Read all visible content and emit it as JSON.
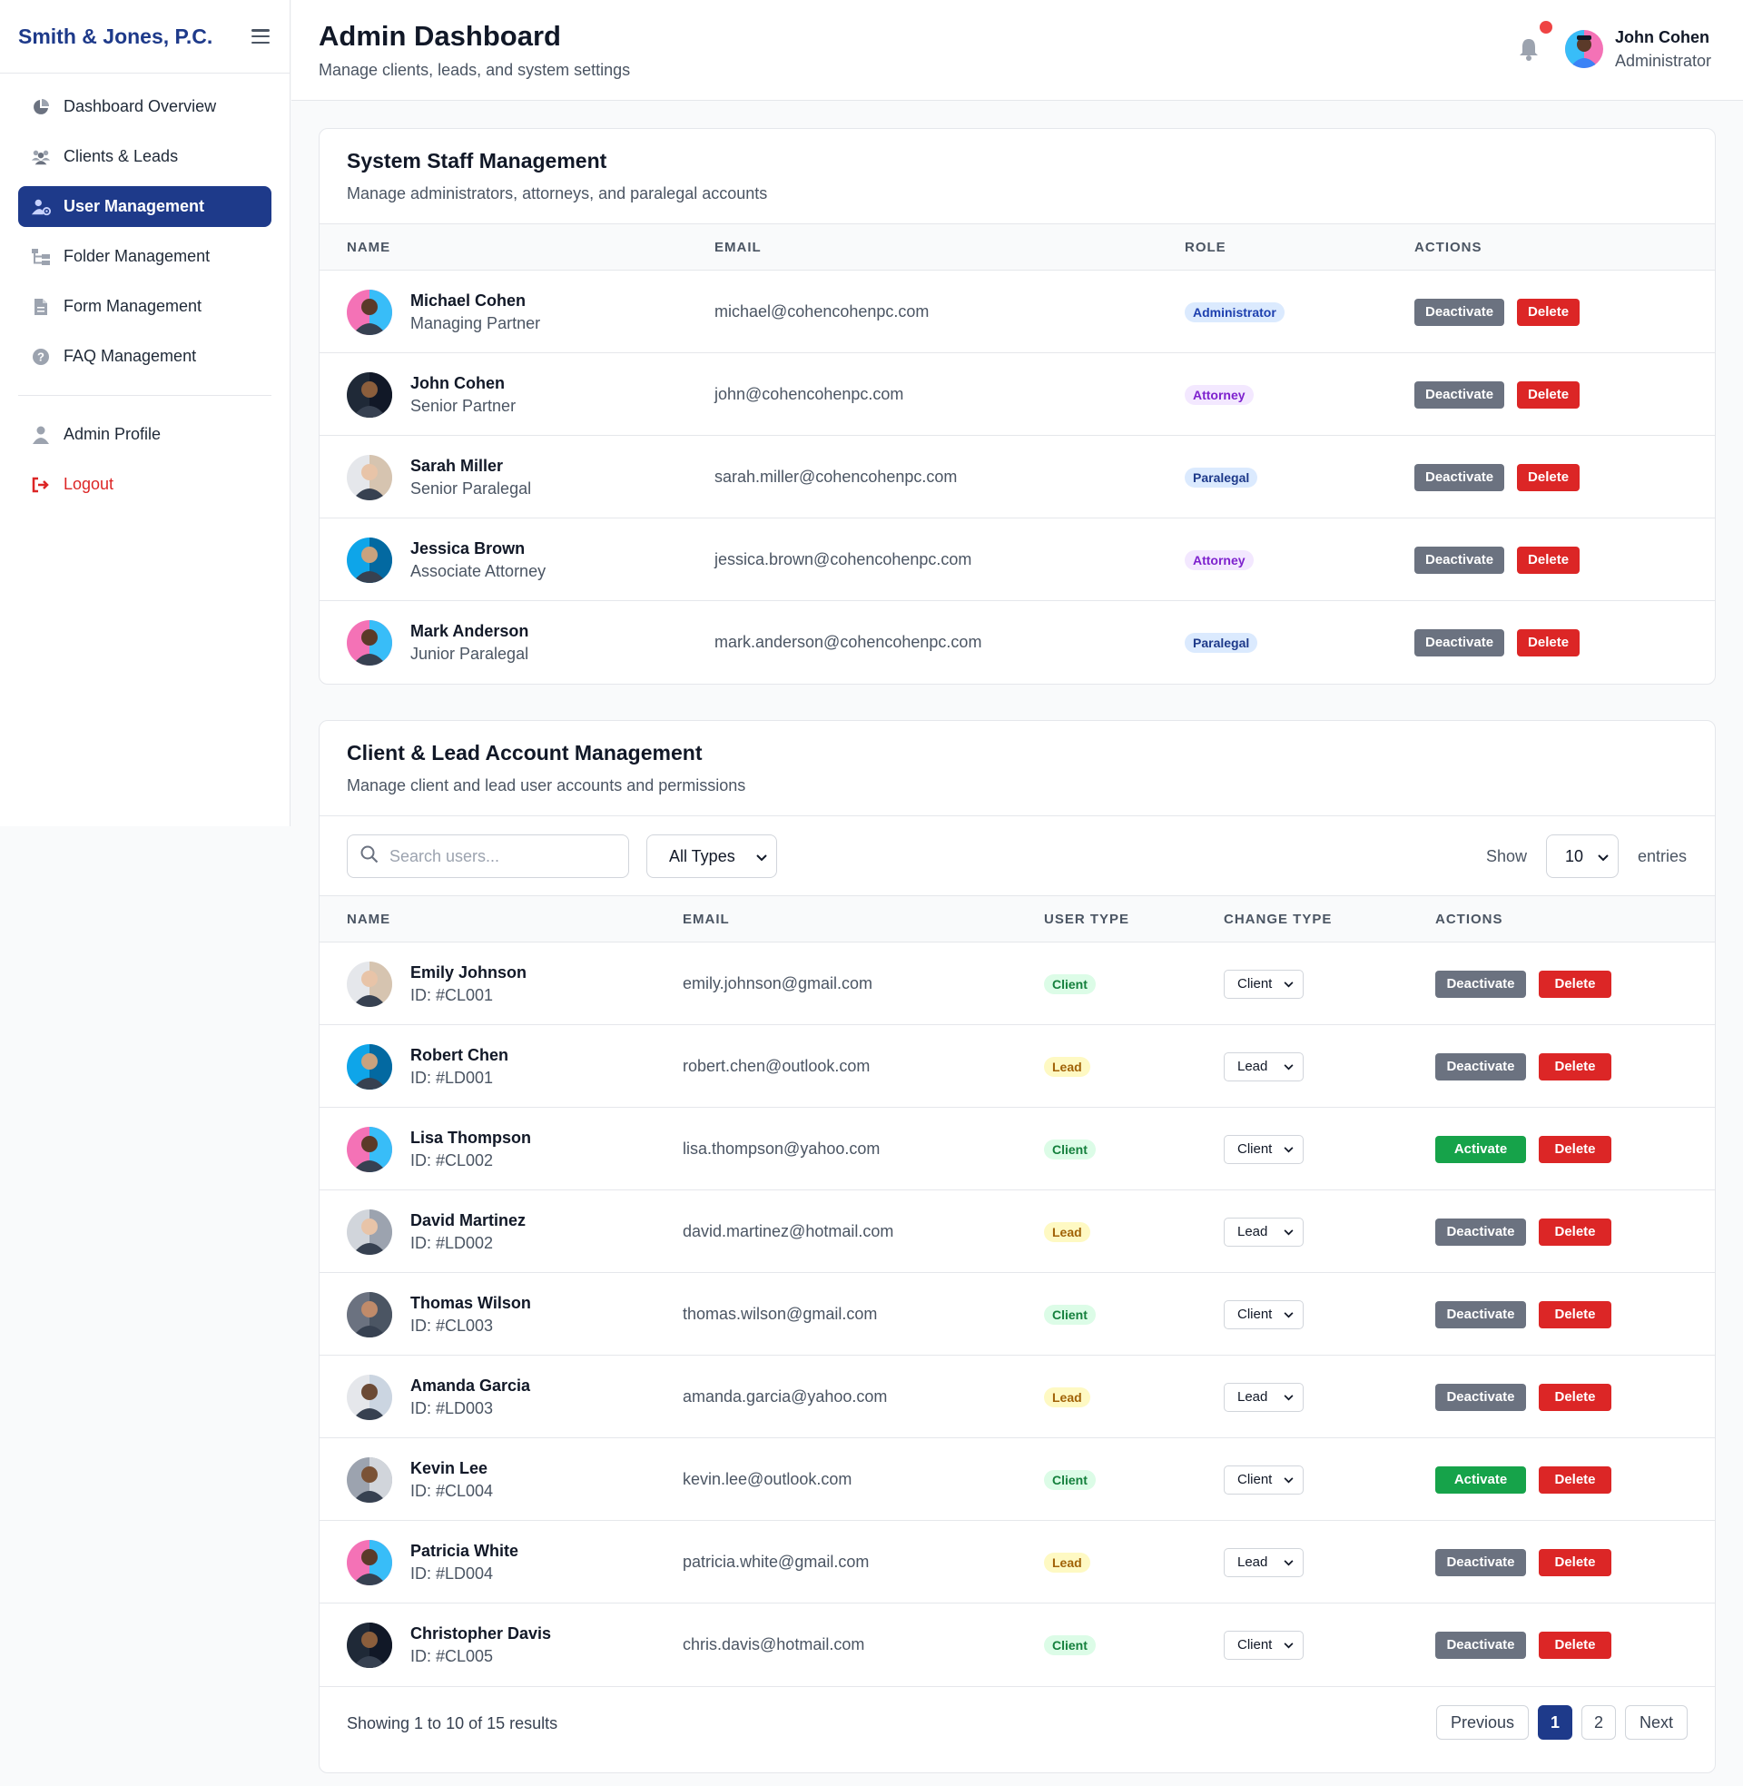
{
  "brand": "Smith & Jones, P.C.",
  "nav": {
    "items": [
      {
        "label": "Dashboard Overview",
        "icon": "pie-chart-icon"
      },
      {
        "label": "Clients & Leads",
        "icon": "users-icon"
      },
      {
        "label": "User Management",
        "icon": "user-gear-icon"
      },
      {
        "label": "Folder Management",
        "icon": "folder-tree-icon"
      },
      {
        "label": "Form Management",
        "icon": "file-icon"
      },
      {
        "label": "FAQ Management",
        "icon": "question-circle-icon"
      }
    ],
    "profile": "Admin Profile",
    "logout": "Logout"
  },
  "header": {
    "title": "Admin Dashboard",
    "subtitle": "Manage clients, leads, and system settings",
    "user_name": "John Cohen",
    "user_role": "Administrator"
  },
  "staff": {
    "title": "System Staff Management",
    "subtitle": "Manage administrators, attorneys, and paralegal accounts",
    "columns": [
      "Name",
      "Email",
      "Role",
      "Actions"
    ],
    "deactivate": "Deactivate",
    "delete": "Delete",
    "rows": [
      {
        "name": "Michael Cohen",
        "title": "Managing Partner",
        "email": "michael@cohencohenpc.com",
        "role": "Administrator"
      },
      {
        "name": "John Cohen",
        "title": "Senior Partner",
        "email": "john@cohencohenpc.com",
        "role": "Attorney"
      },
      {
        "name": "Sarah Miller",
        "title": "Senior Paralegal",
        "email": "sarah.miller@cohencohenpc.com",
        "role": "Paralegal"
      },
      {
        "name": "Jessica Brown",
        "title": "Associate Attorney",
        "email": "jessica.brown@cohencohenpc.com",
        "role": "Attorney"
      },
      {
        "name": "Mark Anderson",
        "title": "Junior Paralegal",
        "email": "mark.anderson@cohencohenpc.com",
        "role": "Paralegal"
      }
    ]
  },
  "clients": {
    "title": "Client & Lead Account Management",
    "subtitle": "Manage client and lead user accounts and permissions",
    "search_placeholder": "Search users...",
    "type_filter": "All Types",
    "show_label": "Show",
    "show_value": "10",
    "entries_label": "entries",
    "columns": [
      "Name",
      "Email",
      "User Type",
      "Change Type",
      "Actions"
    ],
    "delete": "Delete",
    "rows": [
      {
        "name": "Emily Johnson",
        "id": "ID: #CL001",
        "email": "emily.johnson@gmail.com",
        "type": "Client",
        "change": "Client",
        "action": "Deactivate"
      },
      {
        "name": "Robert Chen",
        "id": "ID: #LD001",
        "email": "robert.chen@outlook.com",
        "type": "Lead",
        "change": "Lead",
        "action": "Deactivate"
      },
      {
        "name": "Lisa Thompson",
        "id": "ID: #CL002",
        "email": "lisa.thompson@yahoo.com",
        "type": "Client",
        "change": "Client",
        "action": "Activate"
      },
      {
        "name": "David Martinez",
        "id": "ID: #LD002",
        "email": "david.martinez@hotmail.com",
        "type": "Lead",
        "change": "Lead",
        "action": "Deactivate"
      },
      {
        "name": "Thomas Wilson",
        "id": "ID: #CL003",
        "email": "thomas.wilson@gmail.com",
        "type": "Client",
        "change": "Client",
        "action": "Deactivate"
      },
      {
        "name": "Amanda Garcia",
        "id": "ID: #LD003",
        "email": "amanda.garcia@yahoo.com",
        "type": "Lead",
        "change": "Lead",
        "action": "Deactivate"
      },
      {
        "name": "Kevin Lee",
        "id": "ID: #CL004",
        "email": "kevin.lee@outlook.com",
        "type": "Client",
        "change": "Client",
        "action": "Activate"
      },
      {
        "name": "Patricia White",
        "id": "ID: #LD004",
        "email": "patricia.white@gmail.com",
        "type": "Lead",
        "change": "Lead",
        "action": "Deactivate"
      },
      {
        "name": "Christopher Davis",
        "id": "ID: #CL005",
        "email": "chris.davis@hotmail.com",
        "type": "Client",
        "change": "Client",
        "action": "Deactivate"
      }
    ],
    "showing": "Showing 1 to 10 of 15 results",
    "pager": {
      "prev": "Previous",
      "pages": [
        "1",
        "2"
      ],
      "next": "Next"
    }
  },
  "colors": {
    "brand": "#1e3a8a",
    "danger": "#dc2626",
    "success": "#16a34a",
    "muted": "#6b7280"
  }
}
